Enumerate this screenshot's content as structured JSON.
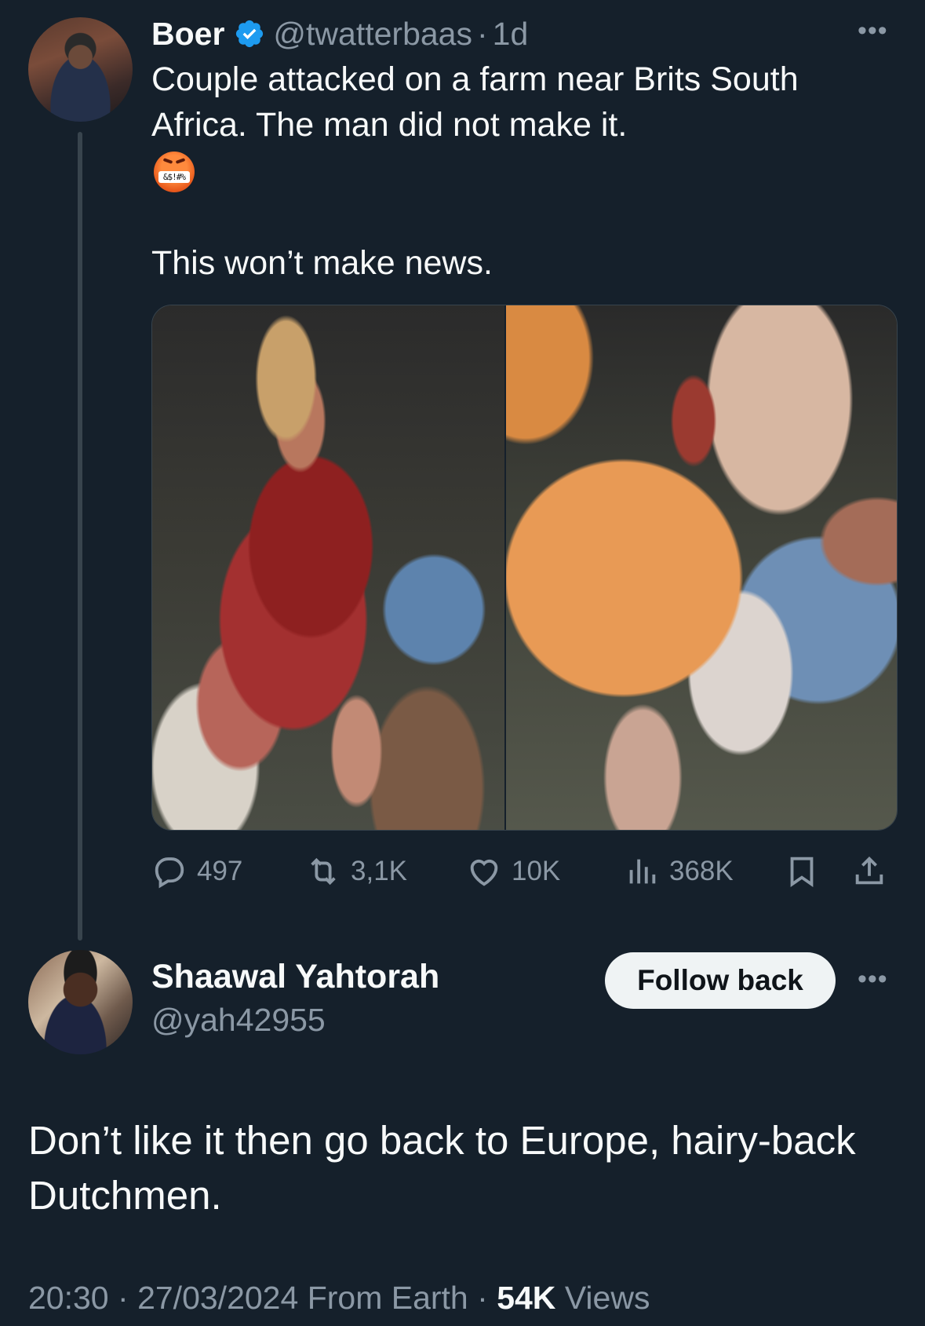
{
  "parent_tweet": {
    "author_name": "Boer",
    "handle": "@twatterbaas",
    "separator": "·",
    "time_ago": "1d",
    "text": "Couple attacked on a farm near Brits South Africa. The man did not make it.",
    "emoji_grawlix": "&$!#%",
    "text_2": "This won’t make news.",
    "stats": {
      "replies": "497",
      "reposts": "3,1K",
      "likes": "10K",
      "views": "368K"
    }
  },
  "reply_tweet": {
    "author_name": "Shaawal Yahtorah",
    "handle": "@yah42955",
    "follow_button": "Follow back",
    "text": "Don’t like it then go back to Europe, hairy-back Dutchmen.",
    "time": "20:30",
    "date": "27/03/2024",
    "source": "From Earth",
    "separator": "·",
    "views_count": "54K",
    "views_label": "Views"
  },
  "icons": {
    "more": "more-horizontal-icon",
    "verified": "verified-badge-icon",
    "reply": "reply-icon",
    "repost": "repost-icon",
    "like": "heart-icon",
    "views": "views-icon",
    "bookmark": "bookmark-icon",
    "share": "share-icon"
  },
  "colors": {
    "background": "#15202b",
    "text_primary": "#f7f9f9",
    "text_secondary": "#8b98a5",
    "verified_blue": "#1d9bf0",
    "follow_button_bg": "#eff3f4"
  }
}
